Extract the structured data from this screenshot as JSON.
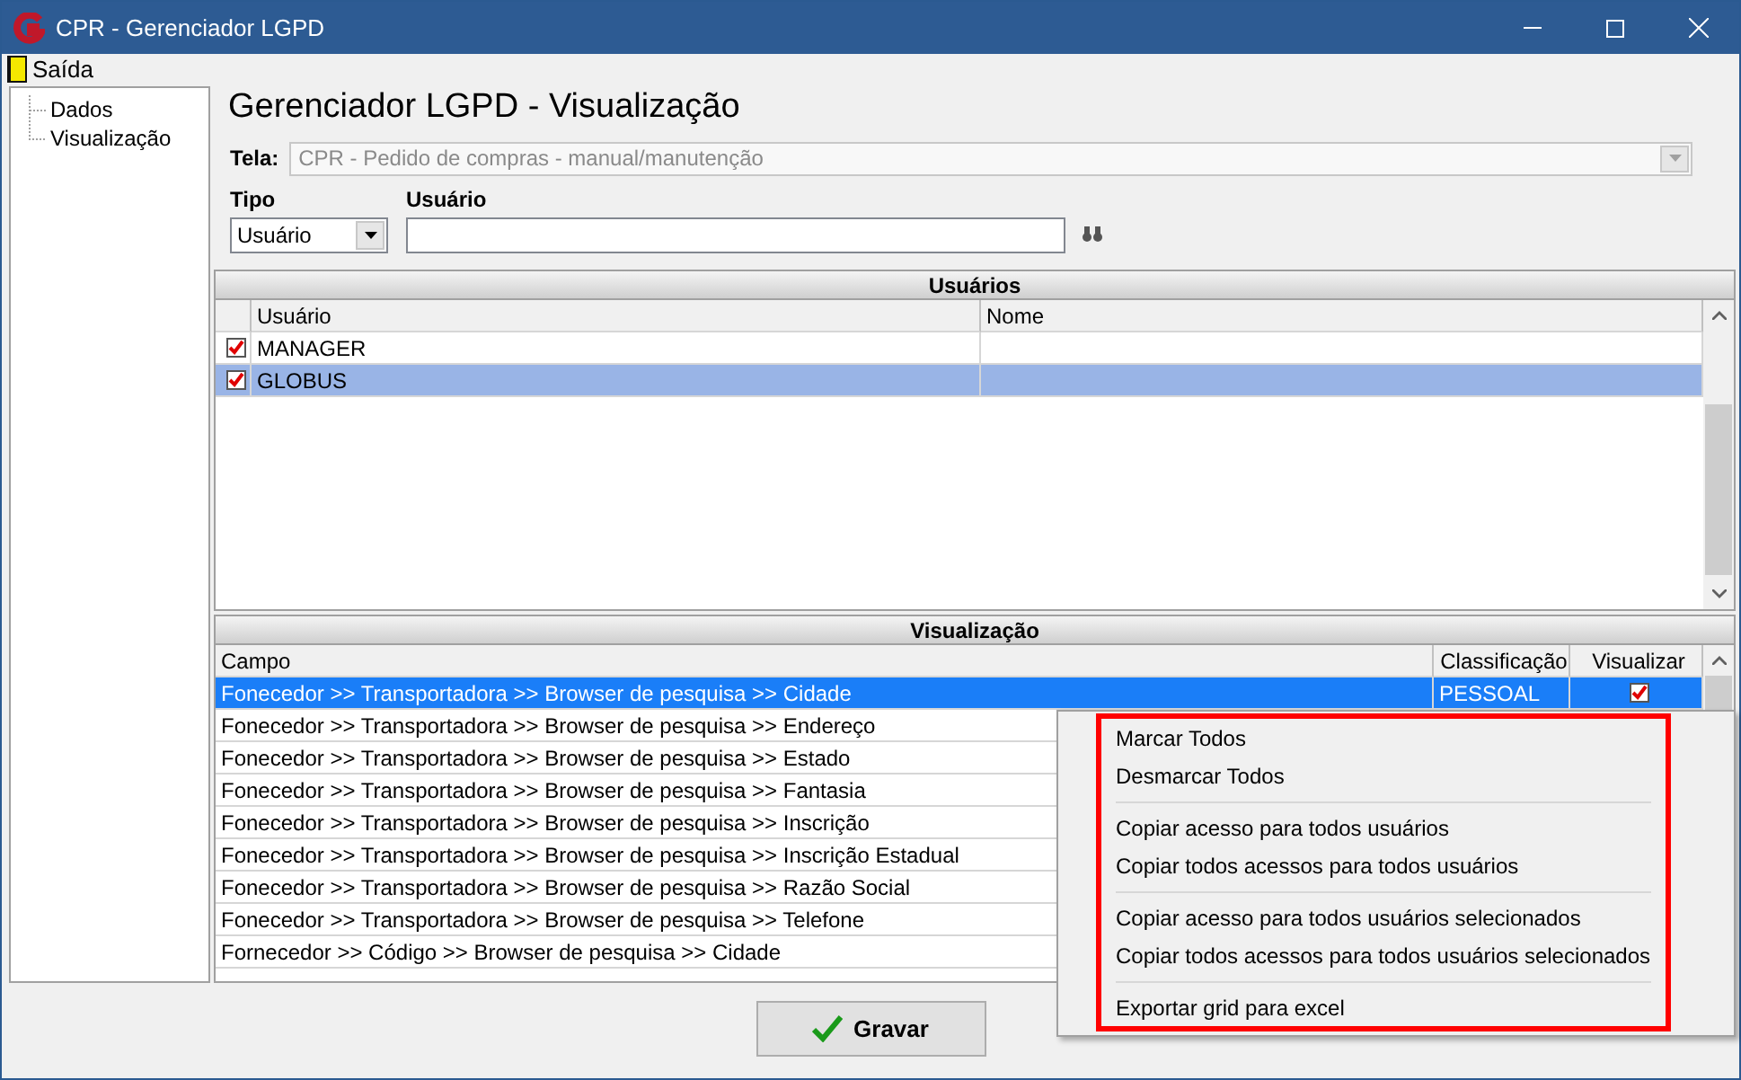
{
  "window": {
    "title": "CPR - Gerenciador LGPD"
  },
  "menu": [
    {
      "label": "Saída"
    }
  ],
  "tree": [
    {
      "label": "Dados"
    },
    {
      "label": "Visualização"
    }
  ],
  "heading": "Gerenciador LGPD - Visualização",
  "tela": {
    "label": "Tela:",
    "value": "CPR - Pedido de compras - manual/manutenção",
    "disabled": true
  },
  "tipo": {
    "label": "Tipo",
    "value": "Usuário"
  },
  "usuario": {
    "label": "Usuário"
  },
  "users_grid": {
    "title": "Usuários",
    "columns": [
      "Usuário",
      "Nome"
    ],
    "rows": [
      {
        "checked": true,
        "usuario": "MANAGER",
        "selected": false
      },
      {
        "checked": true,
        "usuario": "GLOBUS",
        "selected": true
      }
    ]
  },
  "view_grid": {
    "title": "Visualização",
    "columns": [
      "Campo",
      "Classificação",
      "Visualizar"
    ],
    "rows": [
      {
        "campo": "Fonecedor >> Transportadora >> Browser de pesquisa >> Cidade",
        "classificacao": "PESSOAL",
        "visualizar": true,
        "selected": true
      },
      {
        "campo": "Fonecedor >> Transportadora >> Browser de pesquisa >> Endereço",
        "selected": false
      },
      {
        "campo": "Fonecedor >> Transportadora >> Browser de pesquisa >> Estado",
        "selected": false
      },
      {
        "campo": "Fonecedor >> Transportadora >> Browser de pesquisa >> Fantasia",
        "selected": false
      },
      {
        "campo": "Fonecedor >> Transportadora >> Browser de pesquisa >> Inscrição",
        "selected": false
      },
      {
        "campo": "Fonecedor >> Transportadora >> Browser de pesquisa >> Inscrição Estadual",
        "selected": false
      },
      {
        "campo": "Fonecedor >> Transportadora >> Browser de pesquisa >> Razão Social",
        "selected": false
      },
      {
        "campo": "Fonecedor >> Transportadora >> Browser de pesquisa >> Telefone",
        "selected": false
      },
      {
        "campo": "Fornecedor >> Código >> Browser de pesquisa >> Cidade",
        "selected": false
      }
    ]
  },
  "context_menu": {
    "highlighted": true,
    "groups": [
      {
        "items": [
          "Marcar Todos",
          "Desmarcar Todos"
        ]
      },
      {
        "items": [
          "Copiar acesso para todos usuários",
          "Copiar todos acessos para todos usuários"
        ]
      },
      {
        "items": [
          "Copiar acesso para todos usuários selecionados",
          "Copiar todos acessos para todos usuários selecionados"
        ]
      },
      {
        "items": [
          "Exportar grid para excel"
        ]
      }
    ]
  },
  "save_button": {
    "label": "Gravar"
  }
}
